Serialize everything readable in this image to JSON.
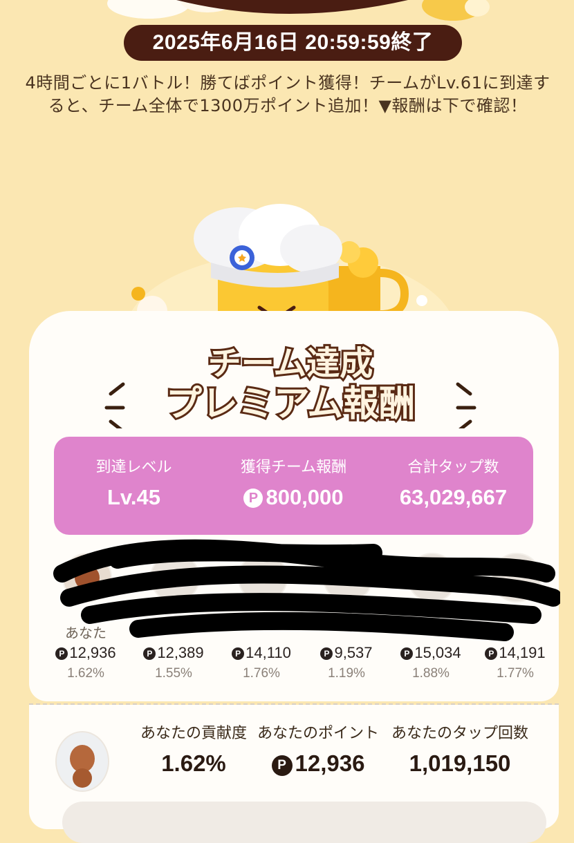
{
  "header": {
    "end_time": "2025年6月16日 20:59:59終了",
    "description": "4時間ごとに1バトル！勝てばポイント獲得！チームがLv.61に到達すると、チーム全体で1300万ポイント追加！▼報酬は下で確認！"
  },
  "title": {
    "line1": "チーム達成",
    "line2": "プレミアム報酬"
  },
  "stats": {
    "level_label": "到達レベル",
    "level_value": "Lv.45",
    "reward_label": "獲得チーム報酬",
    "reward_value": "800,000",
    "taps_label": "合計タップ数",
    "taps_value": "63,029,667"
  },
  "members": [
    {
      "name": "あなた",
      "points": "12,936",
      "pct": "1.62%"
    },
    {
      "name": "",
      "points": "12,389",
      "pct": "1.55%"
    },
    {
      "name": "",
      "points": "14,110",
      "pct": "1.76%"
    },
    {
      "name": "",
      "points": "9,537",
      "pct": "1.19%"
    },
    {
      "name": "",
      "points": "15,034",
      "pct": "1.88%"
    },
    {
      "name": "",
      "points": "14,191",
      "pct": "1.77%"
    }
  ],
  "you": {
    "contribution_label": "あなたの貢献度",
    "contribution_value": "1.62%",
    "points_label": "あなたのポイント",
    "points_value": "12,936",
    "taps_label": "あなたのタップ回数",
    "taps_value": "1,019,150"
  },
  "colors": {
    "background": "#fbe7b2",
    "pill": "#4a1d12",
    "stats_card": "#df84cc"
  }
}
